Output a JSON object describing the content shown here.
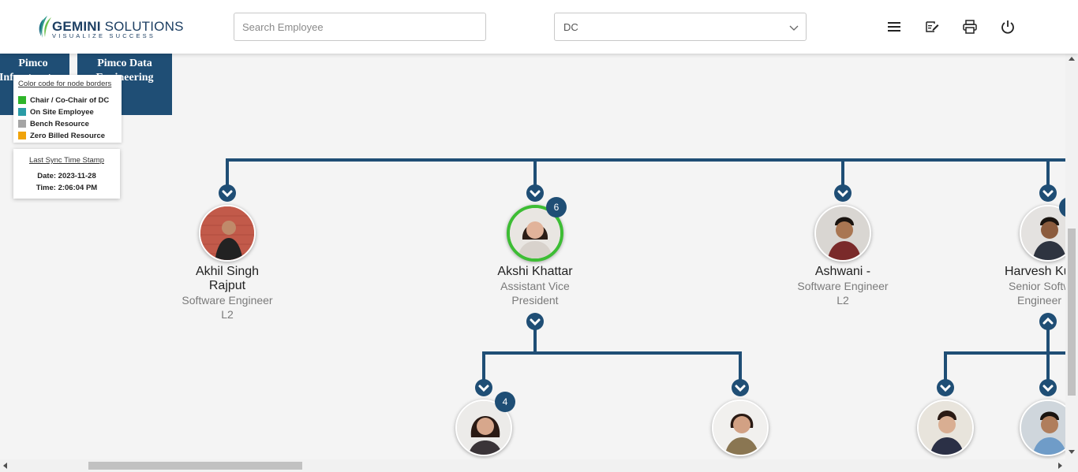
{
  "header": {
    "logo_title_bold": "GEMINI",
    "logo_title_rest": " SOLUTIONS",
    "logo_tagline": "VISUALIZE SUCCESS",
    "search_placeholder": "Search Employee",
    "select_value": "DC",
    "icons": [
      "menu-icon",
      "edit-note-icon",
      "print-icon",
      "power-icon"
    ]
  },
  "top_cards": [
    {
      "label": "Pimco Infrastructure"
    },
    {
      "label": "Pimco Data Engineering"
    }
  ],
  "legend": {
    "title": "Color code for node borders",
    "items": [
      {
        "label": "Chair / Co-Chair of DC",
        "color": "#2fb52a"
      },
      {
        "label": "On Site Employee",
        "color": "#2a9ca6"
      },
      {
        "label": "Bench Resource",
        "color": "#a5a5a5"
      },
      {
        "label": "Zero Billed Resource",
        "color": "#f0a30a"
      }
    ]
  },
  "sync": {
    "title": "Last Sync Time Stamp",
    "date": "Date: 2023-11-28",
    "time": "Time: 2:06:04 PM"
  },
  "employees": [
    {
      "name_line1": "Akhil Singh",
      "name_line2": "Rajput",
      "role_line1": "Software Engineer",
      "role_line2": "L2"
    },
    {
      "name_line1": "Akshi Khattar",
      "role_line1": "Assistant Vice",
      "role_line2": "President",
      "badge": "6",
      "border": "#3dbd34"
    },
    {
      "name_line1": "Ashwani -",
      "role_line1": "Software Engineer",
      "role_line2": "L2"
    },
    {
      "name_line1": "Harvesh Ku",
      "role_line1": "Senior Softw",
      "role_line2": "Engineer"
    }
  ],
  "children_badges": {
    "first": "4"
  },
  "colors": {
    "brand": "#1f4e75",
    "chair_border": "#3dbd34",
    "line": "#1f4e75"
  }
}
